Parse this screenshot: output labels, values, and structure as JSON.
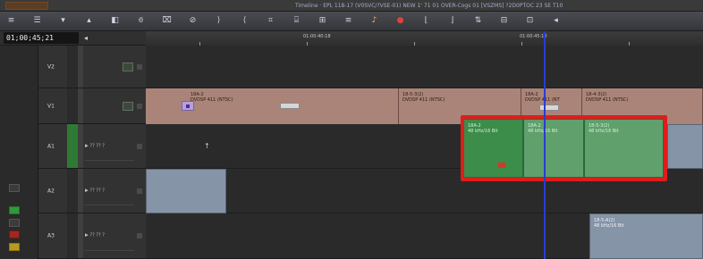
{
  "title_bar": {
    "text": "Timeline · EPL 118-17 (V0SVC/?VSE-01) NEW 1' 71 01 OVER-Cogs 01 [VSZMS] ?2D0PTOC 23 SE T10"
  },
  "toolbar": {
    "buttons": [
      {
        "icon": "menu-icon",
        "glyph": "≡"
      },
      {
        "icon": "list-icon",
        "glyph": "☰"
      },
      {
        "icon": "dropdown-icon",
        "glyph": "▾"
      },
      {
        "icon": "up-icon",
        "glyph": "▴"
      },
      {
        "icon": "segment-icon",
        "glyph": "◧"
      },
      {
        "icon": "split-icon",
        "glyph": "⟃"
      },
      {
        "icon": "overwrite-icon",
        "glyph": "⌧"
      },
      {
        "icon": "no-entry-icon",
        "glyph": "⊘"
      },
      {
        "icon": "mark-in-icon",
        "glyph": "⟩"
      },
      {
        "icon": "mark-out-icon",
        "glyph": "⟨"
      },
      {
        "icon": "lift-icon",
        "glyph": "⌗"
      },
      {
        "icon": "extract-icon",
        "glyph": "⌸"
      },
      {
        "icon": "splice-icon",
        "glyph": "⊞"
      },
      {
        "icon": "overlay-icon",
        "glyph": "≡"
      },
      {
        "icon": "audio-icon",
        "glyph": "♪"
      },
      {
        "icon": "record-icon",
        "glyph": "●"
      },
      {
        "icon": "trim-in-icon",
        "glyph": "⌊"
      },
      {
        "icon": "trim-out-icon",
        "glyph": "⌋"
      },
      {
        "icon": "sync-icon",
        "glyph": "⇅"
      },
      {
        "icon": "grid-icon",
        "glyph": "⊟"
      },
      {
        "icon": "stack-icon",
        "glyph": "⊡"
      },
      {
        "icon": "more-icon",
        "glyph": "◂"
      }
    ]
  },
  "timecode": {
    "value": "01;00;45;21",
    "ruler_labels": [
      "01:00:40:18",
      "01:00:45:18"
    ]
  },
  "tracks": [
    {
      "name": "V2"
    },
    {
      "name": "V1"
    },
    {
      "name": "A1",
      "selected": true
    },
    {
      "name": "A2"
    },
    {
      "name": "A3"
    }
  ],
  "audio_header_label": "▶ ?? ?? ?",
  "clips": {
    "v1": [
      {
        "name": "18A-2",
        "format": "DVDSP 411 (NTSC)"
      },
      {
        "name": "18-5-3(2)",
        "format": "DVDSP 411 (NTSC)"
      },
      {
        "name": "18A-2",
        "format": "DVDSP 411 (NT"
      },
      {
        "name": "18-4-3(2)",
        "format": "DVDSP 411 (NTSC)"
      }
    ],
    "a1": [
      {
        "name": "18A-2",
        "format": "48 kHz/16 Bit"
      },
      {
        "name": "18A-2",
        "format": "48 kHz/16 Bit"
      },
      {
        "name": "18-5-3(2)",
        "format": "48 kHz/16 Bit"
      }
    ],
    "a3": [
      {
        "name": "18-5-A(2)",
        "format": "48 kHz/16 Bit"
      }
    ]
  },
  "colors": {
    "video_clip": "#aa8478",
    "audio_clip": "#8594a6",
    "selected_audio": "#3c8c4a",
    "highlight": "#e01c1c",
    "playhead": "#2b3ccf"
  }
}
